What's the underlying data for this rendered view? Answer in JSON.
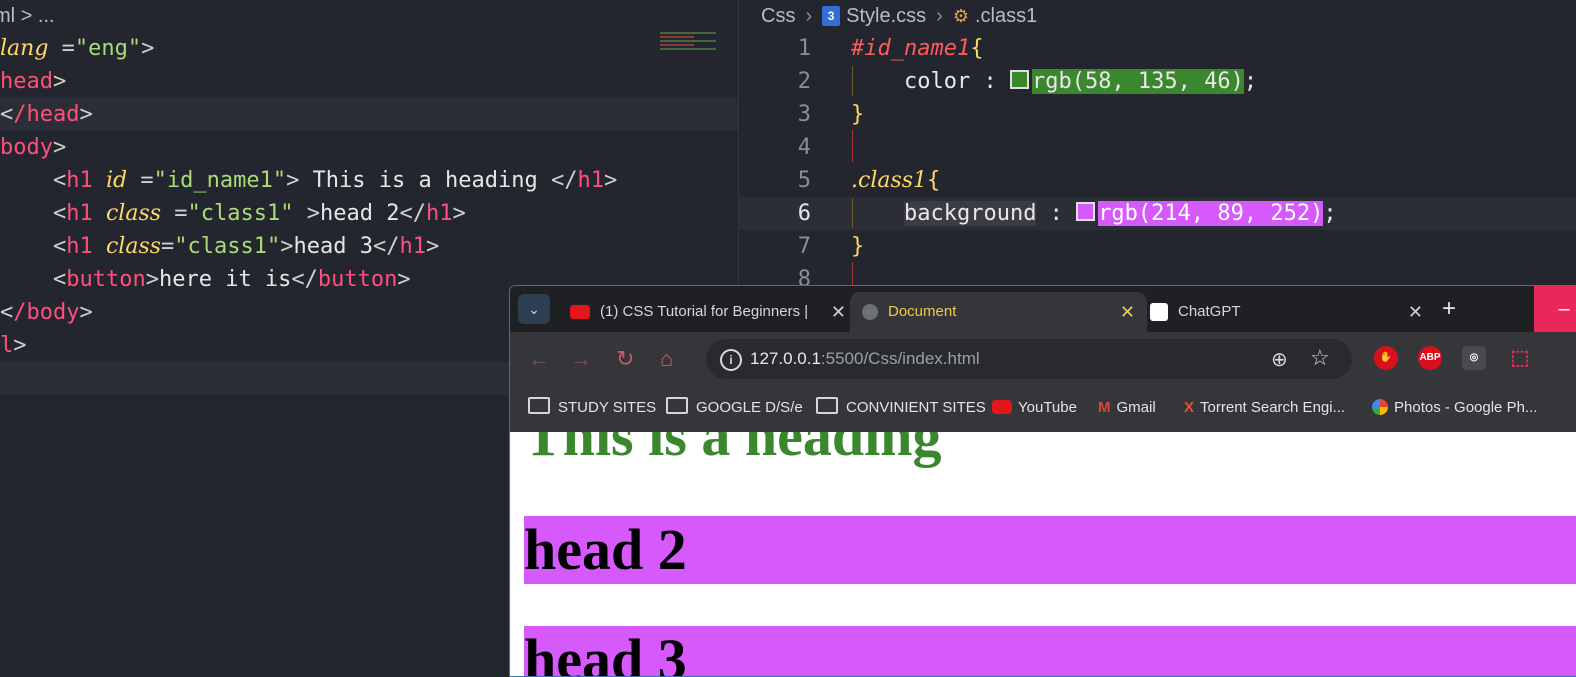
{
  "left_editor": {
    "breadcrumb": "ml > ...",
    "lines": [
      {
        "parts": [
          "",
          "lang",
          " =",
          "\"eng\"",
          ">"
        ]
      },
      {
        "tag": "head"
      },
      {
        "tag": "/head"
      },
      {
        "tag": "body"
      },
      {
        "text": "This is a heading",
        "attr": "id",
        "value": "\"id_name1\""
      },
      {
        "text": "head 2",
        "attr": "class",
        "value": "\"class1\""
      },
      {
        "text": "head 3",
        "attr": "class",
        "value": "\"class1\""
      },
      {
        "text": "here it is",
        "tag": "button"
      },
      {
        "tag": "/body"
      },
      {
        "tag": "l"
      }
    ],
    "code": {
      "l1_attr": "lang",
      "l1_eq": " =",
      "l1_val": "\"eng\"",
      "l1_end": ">",
      "l2_tag": "head",
      "l3_tag": "/head",
      "l4_tag": "body",
      "h1": "h1",
      "id_attr": "id",
      "id_val": "\"id_name1\"",
      "heading_text": " This is a heading ",
      "class_attr": "class",
      "class_val": "\"class1\"",
      "head2_text": "head 2",
      "head3_text": "head 3",
      "button": "button",
      "button_text": "here it is",
      "body_close": "/body",
      "html_close": "l"
    }
  },
  "right_editor": {
    "breadcrumb": {
      "folder": "Css",
      "file": "Style.css",
      "symbol": ".class1"
    },
    "line_numbers": [
      "1",
      "2",
      "3",
      "4",
      "5",
      "6",
      "7",
      "8"
    ],
    "active_line": "6",
    "code": {
      "sel1": "#id_name1",
      "prop_color": "color",
      "val_color": "rgb(58, 135, 46)",
      "sel2": ".class1",
      "prop_background": "background",
      "val_background": "rgb(214, 89, 252)"
    },
    "colors": {
      "green": "#3a872e",
      "pink": "#d659fc"
    }
  },
  "browser": {
    "tabs": [
      {
        "title": "(1) CSS Tutorial for Beginners |",
        "icon": "youtube-icon"
      },
      {
        "title": "Document",
        "icon": "globe-icon",
        "active": true
      },
      {
        "title": "ChatGPT",
        "icon": "chatgpt-icon"
      }
    ],
    "url": {
      "host": "127.0.0.1",
      "rest": ":5500/Css/index.html"
    },
    "extensions": [
      "ABP"
    ],
    "bookmarks": [
      "STUDY SITES",
      "GOOGLE D/S/e",
      "CONVINIENT SITES",
      "YouTube",
      "Gmail",
      "Torrent Search Engi...",
      "Photos - Google Ph..."
    ],
    "page": {
      "heading": "This is a heading",
      "head2": "head 2",
      "head3": "head 3"
    }
  }
}
